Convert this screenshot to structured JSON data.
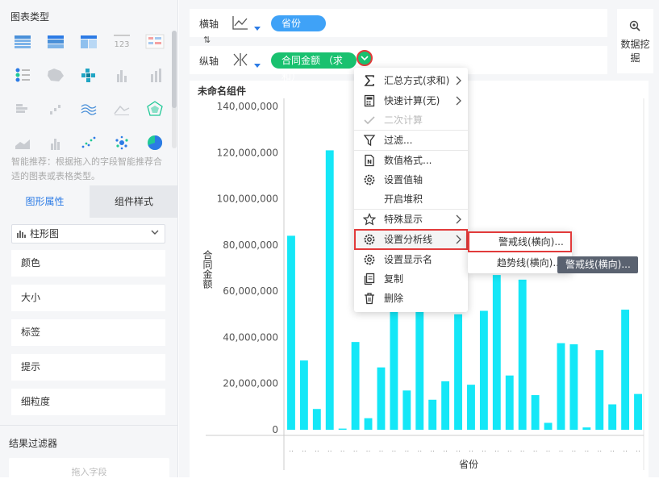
{
  "left_panel": {
    "chart_types_title": "图表类型",
    "hint": "智能推荐：根据拖入的字段智能推荐合适的图表或表格类型。",
    "tabs": [
      "图形属性",
      "组件样式"
    ],
    "chart_type_select": "柱形图",
    "properties": [
      "颜色",
      "大小",
      "标签",
      "提示",
      "细粒度"
    ],
    "result_filter_title": "结果过滤器",
    "drop_field": "拖入字段"
  },
  "axes": {
    "x_label": "横轴",
    "x_field": "省份",
    "y_label": "纵轴",
    "y_field": "合同金额 （求和）"
  },
  "data_mining": "数据挖掘",
  "component_title": "未命名组件",
  "context_menu": {
    "items": [
      {
        "icon": "sigma-icon",
        "label": "汇总方式(求和)",
        "submenu": true
      },
      {
        "icon": "quick-calc-icon",
        "label": "快速计算(无)",
        "submenu": true
      },
      {
        "icon": "check-icon",
        "label": "二次计算",
        "disabled": true
      },
      {
        "icon": "filter-icon",
        "label": "过滤..."
      },
      {
        "icon": "number-format-icon",
        "label": "数值格式..."
      },
      {
        "icon": "gear-icon",
        "label": "设置值轴"
      },
      {
        "icon": "",
        "label": "开启堆积"
      },
      {
        "icon": "star-icon",
        "label": "特殊显示",
        "submenu": true
      },
      {
        "icon": "gear-icon",
        "label": "设置分析线",
        "submenu": true
      },
      {
        "icon": "gear-icon",
        "label": "设置显示名"
      },
      {
        "icon": "copy-icon",
        "label": "复制"
      },
      {
        "icon": "trash-icon",
        "label": "删除"
      }
    ]
  },
  "submenu": {
    "items": [
      "警戒线(横向)...",
      "趋势线(横向)..."
    ]
  },
  "tooltip": "警戒线(横向)...",
  "colors": {
    "bar": "#14e7f7",
    "accent": "#2c7be5",
    "highlight": "#e23b3b",
    "green": "#19c16f"
  },
  "chart_data": {
    "type": "bar",
    "xlabel": "省份",
    "ylabel": "合同金额",
    "ylim": [
      0,
      140000000
    ],
    "y_ticks": [
      "0",
      "20,000,000",
      "40,000,000",
      "60,000,000",
      "80,000,000",
      "100,000,000",
      "120,000,000",
      "140,000,000"
    ],
    "values": [
      84000000,
      30000000,
      9000000,
      121000000,
      500000,
      38000000,
      5000000,
      27000000,
      55000000,
      17000000,
      54000000,
      13000000,
      21000000,
      50000000,
      19500000,
      51500000,
      67000000,
      23500000,
      65000000,
      15000000,
      3000000,
      37500000,
      37000000,
      1000000,
      34500000,
      11000000,
      52000000,
      15500000
    ]
  }
}
